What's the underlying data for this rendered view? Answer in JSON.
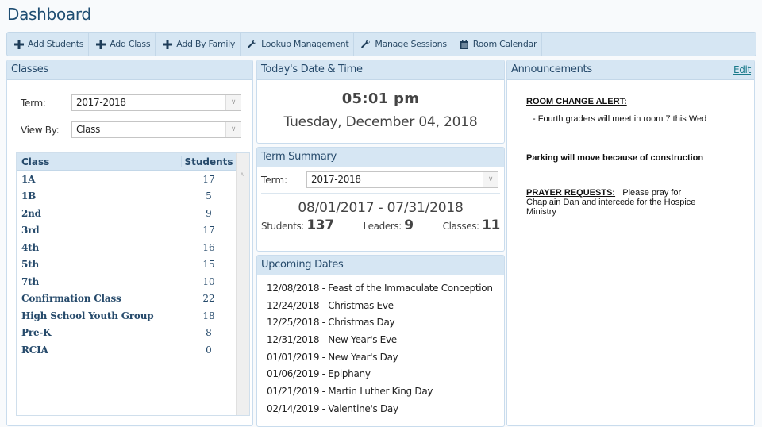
{
  "page": {
    "title": "Dashboard"
  },
  "toolbar": {
    "buttons": [
      {
        "label": "Add Students",
        "icon": "plus-icon"
      },
      {
        "label": "Add Class",
        "icon": "plus-icon"
      },
      {
        "label": "Add By Family",
        "icon": "plus-icon"
      },
      {
        "label": "Lookup Management",
        "icon": "wrench-icon"
      },
      {
        "label": "Manage Sessions",
        "icon": "wrench-icon"
      },
      {
        "label": "Room Calendar",
        "icon": "calendar-icon"
      }
    ]
  },
  "classes": {
    "title": "Classes",
    "term_label": "Term:",
    "term_value": "2017-2018",
    "viewby_label": "View By:",
    "viewby_value": "Class",
    "columns": [
      "Class",
      "Students"
    ],
    "rows": [
      {
        "name": "1A",
        "students": "17"
      },
      {
        "name": "1B",
        "students": "5"
      },
      {
        "name": "2nd",
        "students": "9"
      },
      {
        "name": "3rd",
        "students": "17"
      },
      {
        "name": "4th",
        "students": "16"
      },
      {
        "name": "5th",
        "students": "15"
      },
      {
        "name": "7th",
        "students": "10"
      },
      {
        "name": "Confirmation Class",
        "students": "22"
      },
      {
        "name": "High School Youth Group",
        "students": "18"
      },
      {
        "name": "Pre-K",
        "students": "8"
      },
      {
        "name": "RCIA",
        "students": "0"
      }
    ]
  },
  "datetime": {
    "title": "Today's Date & Time",
    "time": "05:01 pm",
    "date": "Tuesday, December 04, 2018"
  },
  "term_summary": {
    "title": "Term Summary",
    "term_label": "Term:",
    "term_value": "2017-2018",
    "range": "08/01/2017 - 07/31/2018",
    "students_label": "Students:",
    "students": "137",
    "leaders_label": "Leaders:",
    "leaders": "9",
    "classes_label": "Classes:",
    "classes": "11"
  },
  "upcoming": {
    "title": "Upcoming Dates",
    "items": [
      "12/08/2018 - Feast of the Immaculate Conception",
      "12/24/2018 - Christmas Eve",
      "12/25/2018 - Christmas Day",
      "12/31/2018 - New Year's Eve",
      "01/01/2019 - New Year's Day",
      "01/06/2019 - Epiphany",
      "01/21/2019 - Martin Luther King Day",
      "02/14/2019 - Valentine's Day"
    ]
  },
  "announcements": {
    "title": "Announcements",
    "edit_label": "Edit",
    "room_change_heading": "ROOM CHANGE ALERT:",
    "room_change_text": "- Fourth graders will meet in room 7 this Wed",
    "parking_text": "Parking will move because of construction",
    "prayer_heading": "PRAYER REQUESTS:",
    "prayer_text": "Please pray for Chaplain Dan and intercede for the Hospice Ministry"
  },
  "colors": {
    "header_bg": "#d6e6f3",
    "title_color": "#1e4d72",
    "link_color": "#1a7a8a"
  }
}
